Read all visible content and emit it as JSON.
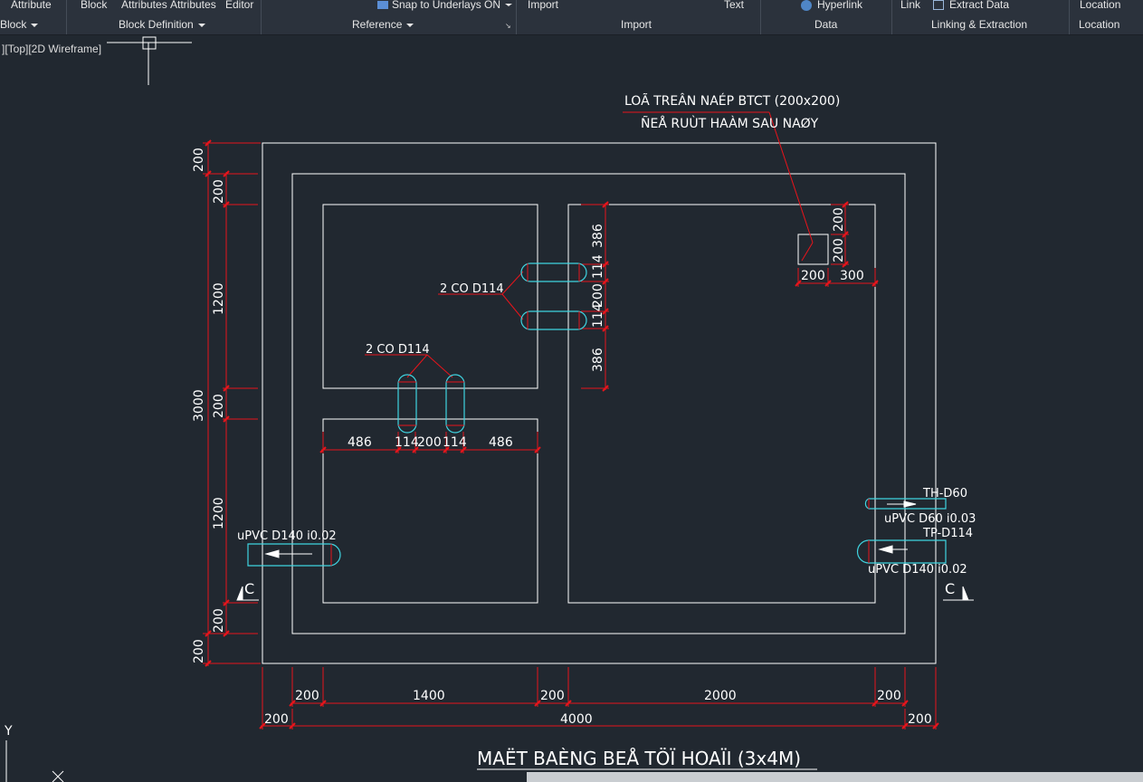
{
  "ribbon": {
    "top_row": [
      "Attribute",
      "Block",
      "Attributes",
      "Attributes",
      "Editor",
      "Snap to Underlays ON",
      "Import",
      "Text",
      "Hyperlink",
      "Link",
      "Extract",
      "Data",
      "Location"
    ],
    "panels": [
      "Block",
      "Block Definition",
      "Reference",
      "Import",
      "Data",
      "Linking & Extraction",
      "Location"
    ]
  },
  "viewport": {
    "label": "][Top][2D Wireframe]"
  },
  "drawing": {
    "title": "MAËT BAÈNG BEÅ TÖÏ HOAÏI (3x4M)",
    "notes": {
      "opening_line1": "LOÃ TREÂN NAÉP BTCT (200x200)",
      "opening_line2": "ÑEÅ RUÙT HAÀM SAU NAØY",
      "pipes_right": "2 CO D114",
      "pipes_bottom": "2 CO D114",
      "inlet_pipe": "uPVC D140 i0.02",
      "th_label": "TH-D60",
      "outlet_d60": "uPVC D60 i0.03",
      "tp_label": "TP-D114",
      "outlet_d140": "uPVC D140 i0.02",
      "section_left": "C",
      "section_right": "C"
    },
    "dims": {
      "left_outer": [
        "200",
        "3000",
        "200"
      ],
      "left_inner": [
        "200",
        "1200",
        "200",
        "1200",
        "200"
      ],
      "bottom_inner": [
        "200",
        "1400",
        "200",
        "2000",
        "200"
      ],
      "bottom_outer": [
        "200",
        "4000",
        "200"
      ],
      "pipe_vertical": [
        "386",
        "114",
        "200",
        "114",
        "386"
      ],
      "pipe_horizontal": [
        "486",
        "114",
        "200",
        "114",
        "486"
      ],
      "opening_vertical": [
        "200",
        "200"
      ],
      "opening_horizontal": [
        "200",
        "300"
      ]
    },
    "ucs": {
      "y": "Y",
      "x": "X"
    }
  }
}
